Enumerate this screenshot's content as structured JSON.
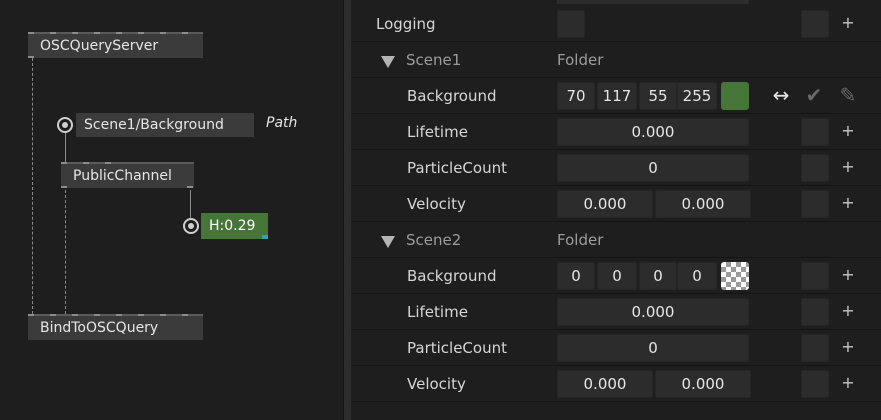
{
  "patch": {
    "nodes": {
      "osc_query_server": "OSCQueryServer",
      "public_channel": "PublicChannel",
      "bind_to_osc_query": "BindToOSCQuery"
    },
    "path_iobox": "Scene1/Background",
    "path_comment": "Path",
    "hue_value": "H:0.29",
    "hue_color": "#467637"
  },
  "inspector": {
    "logging_label": "Logging",
    "scenes": [
      {
        "name": "Scene1",
        "type": "Folder",
        "background": {
          "label": "Background",
          "r": "70",
          "g": "117",
          "b": "55",
          "a": "255",
          "color": "#467637"
        },
        "lifetime": {
          "label": "Lifetime",
          "value": "0.000"
        },
        "particle_count": {
          "label": "ParticleCount",
          "value": "0"
        },
        "velocity": {
          "label": "Velocity",
          "x": "0.000",
          "y": "0.000"
        }
      },
      {
        "name": "Scene2",
        "type": "Folder",
        "background": {
          "label": "Background",
          "r": "0",
          "g": "0",
          "b": "0",
          "a": "0",
          "color": "transparent"
        },
        "lifetime": {
          "label": "Lifetime",
          "value": "0.000"
        },
        "particle_count": {
          "label": "ParticleCount",
          "value": "0"
        },
        "velocity": {
          "label": "Velocity",
          "x": "0.000",
          "y": "0.000"
        }
      }
    ],
    "tools": {
      "bind_glyph": "↔",
      "check_glyph": "✔",
      "edit_glyph": "✎",
      "add_glyph": "+"
    }
  }
}
